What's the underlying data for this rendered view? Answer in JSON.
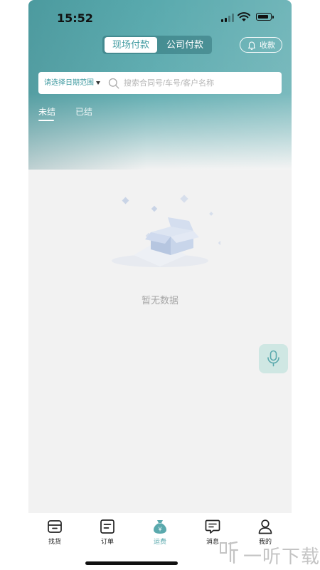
{
  "status_bar": {
    "time": "15:52"
  },
  "header": {
    "segment": {
      "active": "现场付款",
      "inactive": "公司付款"
    },
    "collect_button": "收款"
  },
  "search": {
    "date_picker": "请选择日期范围",
    "placeholder": "搜索合同号/车号/客户名称"
  },
  "tabs": [
    {
      "label": "未结",
      "active": true
    },
    {
      "label": "已结",
      "active": false
    }
  ],
  "empty_state": {
    "text": "暂无数据"
  },
  "tabbar": {
    "items": [
      {
        "label": "找货",
        "icon": "box-icon"
      },
      {
        "label": "订单",
        "icon": "order-icon"
      },
      {
        "label": "运费",
        "icon": "money-bag-icon",
        "active": true
      },
      {
        "label": "消息",
        "icon": "message-icon"
      },
      {
        "label": "我的",
        "icon": "user-icon"
      }
    ]
  },
  "watermark": {
    "text": "一听下载"
  },
  "colors": {
    "accent": "#5aa9ad",
    "background": "#f2f2f2",
    "voice_button": "#cfe7e3"
  }
}
